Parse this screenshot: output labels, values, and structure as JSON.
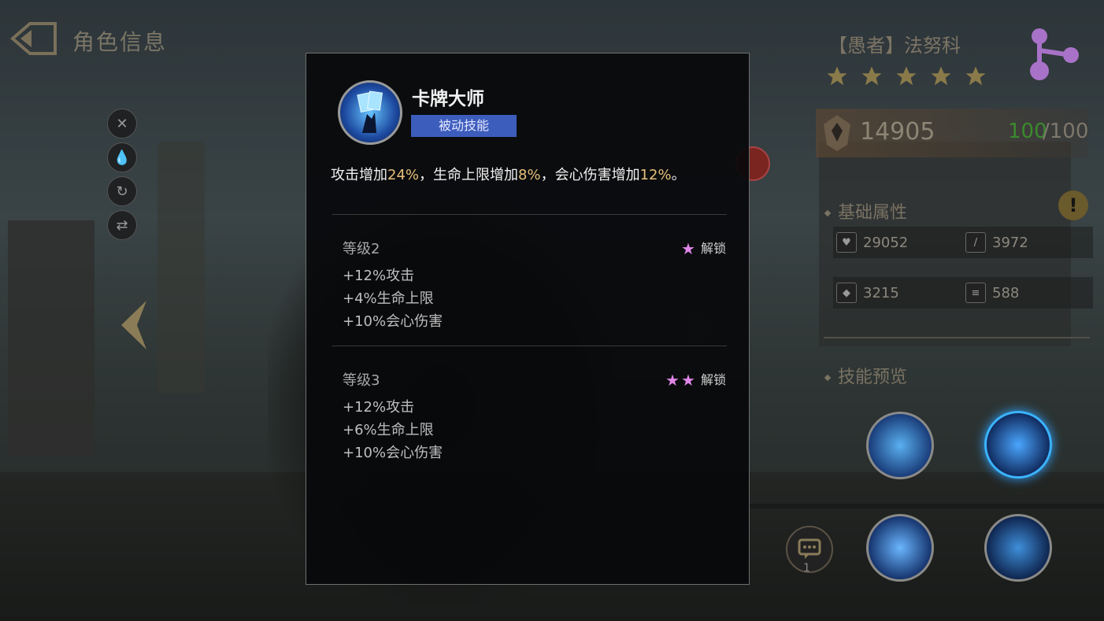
{
  "header": {
    "title": "角色信息"
  },
  "hero": {
    "name": "【愚者】法努科",
    "stars": 5,
    "power": "14905",
    "hp_current": "100",
    "hp_max": "/100"
  },
  "basic_attrs": {
    "title": "基础属性",
    "items": [
      {
        "icon": "heart-icon",
        "value": "29052"
      },
      {
        "icon": "sword-icon",
        "value": "3972"
      },
      {
        "icon": "shield-icon",
        "value": "3215"
      },
      {
        "icon": "speed-icon",
        "value": "588"
      }
    ]
  },
  "skill_preview": {
    "title": "技能预览"
  },
  "chat": {
    "count": "1"
  },
  "modal": {
    "skill_name": "卡牌大师",
    "skill_type": "被动技能",
    "description": {
      "p1": "攻击增加",
      "v1": "24%",
      "p2": "，生命上限增加",
      "v2": "8%",
      "p3": "，会心伤害增加",
      "v3": "12%",
      "p4": "。"
    },
    "levels": [
      {
        "title": "等级2",
        "unlock_label": "解锁",
        "stars": 1,
        "bonuses": [
          "+12%攻击",
          "+4%生命上限",
          "+10%会心伤害"
        ]
      },
      {
        "title": "等级3",
        "unlock_label": "解锁",
        "stars": 2,
        "bonuses": [
          "+12%攻击",
          "+6%生命上限",
          "+10%会心伤害"
        ]
      }
    ]
  },
  "colors": {
    "highlight": "#e6c07a",
    "star_pink": "#e086e8",
    "skill_type_bg": "#3d5dbd",
    "hp_green": "#3b8a2e"
  }
}
